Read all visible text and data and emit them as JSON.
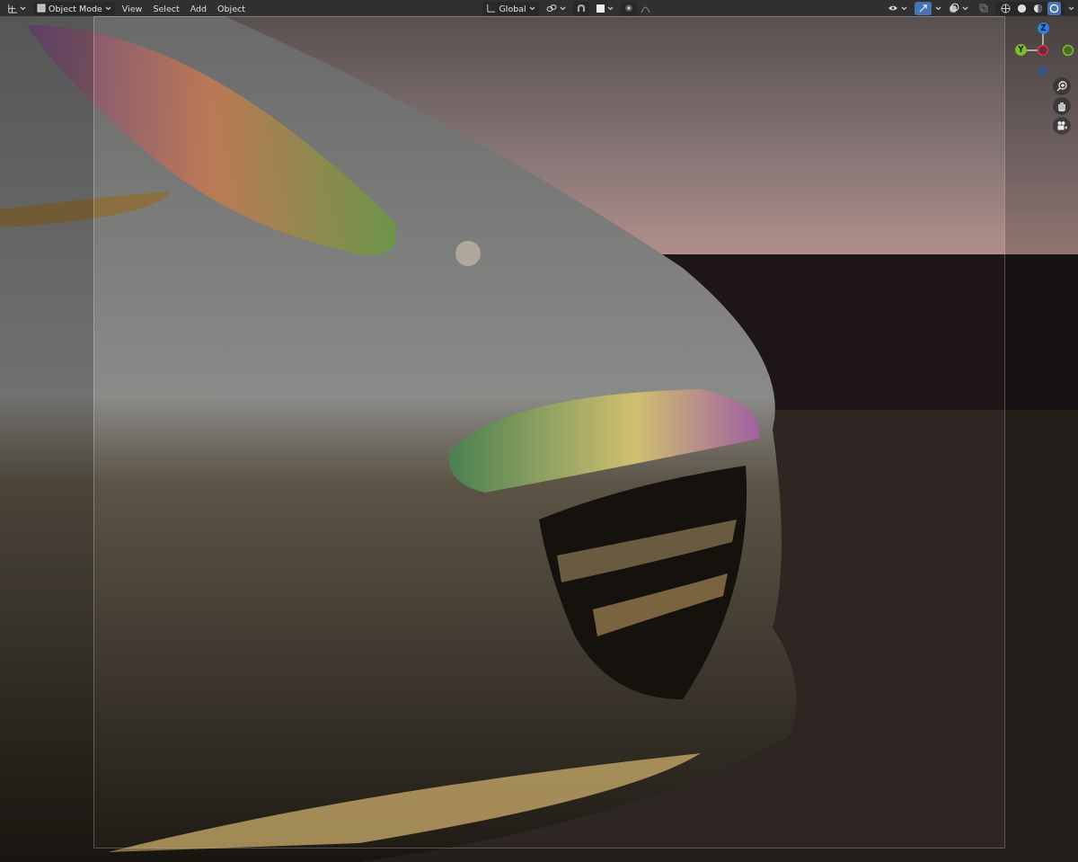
{
  "header": {
    "mode": "Object Mode",
    "menus": [
      "View",
      "Select",
      "Add",
      "Object"
    ],
    "orientation": "Global",
    "snapping": {
      "on": false
    },
    "proportional": {
      "on": false
    },
    "gizmos": {
      "on": true
    },
    "xray": {
      "on": false
    },
    "shading_modes": [
      {
        "kind": "wireframe",
        "selected": false
      },
      {
        "kind": "solid",
        "selected": false
      },
      {
        "kind": "material",
        "selected": false
      },
      {
        "kind": "rendered",
        "selected": true
      }
    ]
  },
  "navigation_gizmo": {
    "axes": [
      {
        "kind": "z",
        "label": "Z",
        "color": "#2f7fe0"
      },
      {
        "kind": "y",
        "label": "Y",
        "color": "#80c020"
      }
    ]
  },
  "viewport": {
    "kind": "picture",
    "camera_frame": true
  }
}
